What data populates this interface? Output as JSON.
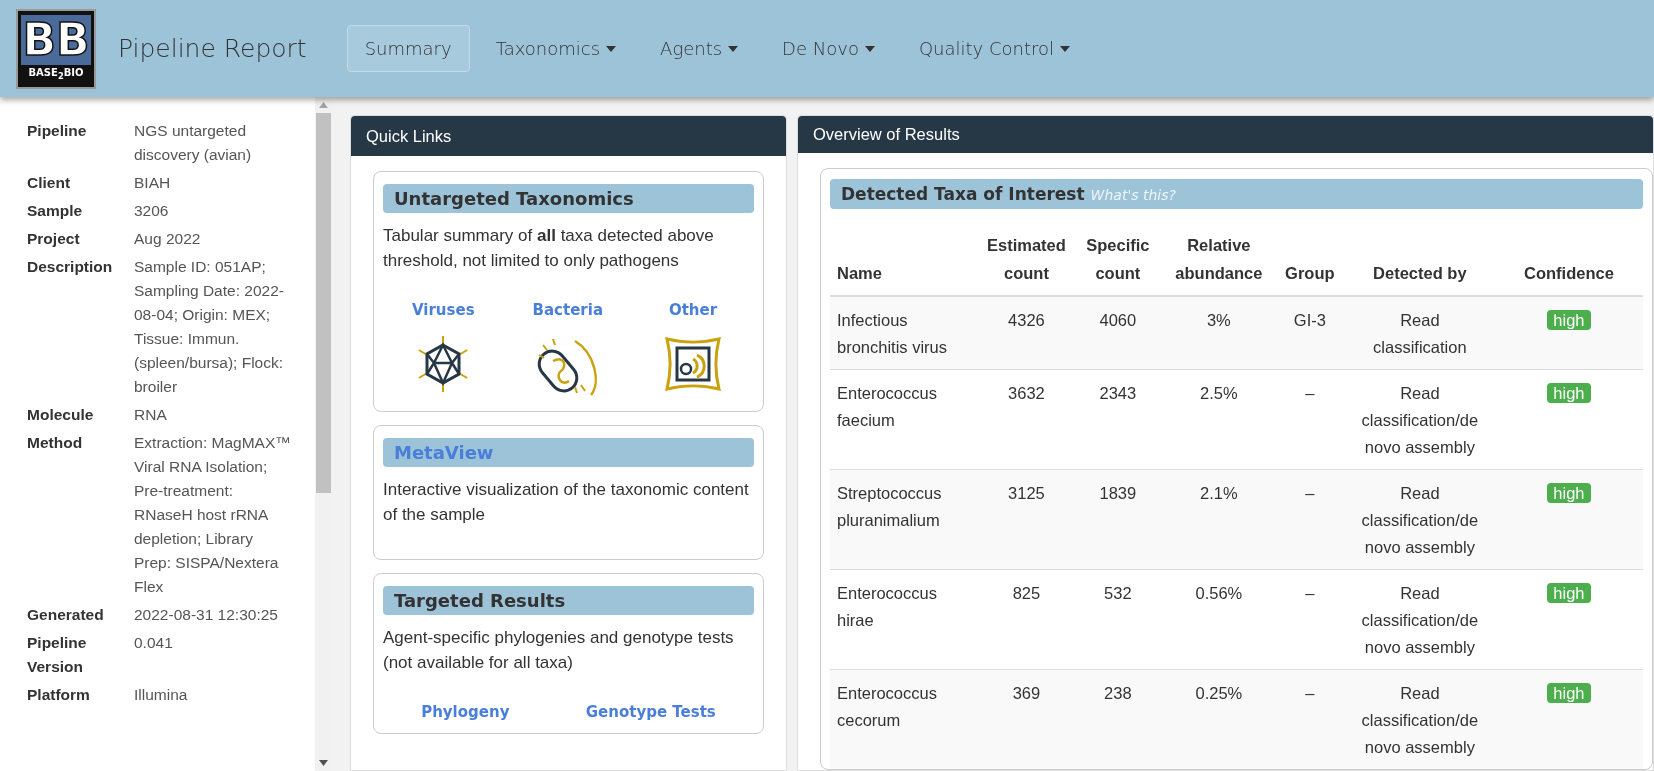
{
  "header": {
    "logo": {
      "letters": [
        "B",
        "B"
      ],
      "wordmark": "BASE$_{2}$BIO"
    },
    "title": "Pipeline Report",
    "nav": [
      {
        "label": "Summary",
        "selected": true,
        "dropdown": false
      },
      {
        "label": "Taxonomics",
        "selected": false,
        "dropdown": true
      },
      {
        "label": "Agents",
        "selected": false,
        "dropdown": true
      },
      {
        "label": "De Novo",
        "selected": false,
        "dropdown": true
      },
      {
        "label": "Quality Control",
        "selected": false,
        "dropdown": true
      }
    ]
  },
  "sidebar": {
    "items": [
      {
        "label": "Pipeline",
        "value": "NGS untargeted discovery (avian)"
      },
      {
        "label": "Client",
        "value": "BIAH"
      },
      {
        "label": "Sample",
        "value": "3206"
      },
      {
        "label": "Project",
        "value": "Aug 2022"
      },
      {
        "label": "Description",
        "value": "Sample ID: 051AP; Sampling Date: 2022-08-04; Origin: MEX; Tissue: Immun. (spleen/bursa); Flock: broiler"
      },
      {
        "label": "Molecule",
        "value": "RNA"
      },
      {
        "label": "Method",
        "value": "Extraction: MagMAX™ Viral RNA Isolation; Pre-treatment: RNaseH host rRNA depletion; Library Prep: SISPA/Nextera Flex"
      },
      {
        "label": "Generated",
        "value": "2022-08-31 12:30:25"
      },
      {
        "label": "Pipeline Version",
        "value": "0.041"
      },
      {
        "label": "Platform",
        "value": "Illumina"
      }
    ]
  },
  "quick_links": {
    "title": "Quick Links",
    "cards": [
      {
        "title": "Untargeted Taxonomics",
        "title_is_link": false,
        "text": "Tabular summary of **all** taxa detected above threshold, not limited to only pathogens",
        "links": [
          {
            "label": "Viruses",
            "kind": "virus"
          },
          {
            "label": "Bacteria",
            "kind": "bacteria"
          },
          {
            "label": "Other",
            "kind": "other"
          }
        ]
      },
      {
        "title": "MetaView",
        "title_is_link": true,
        "text": "Interactive visualization of the taxonomic content of the sample"
      },
      {
        "title": "Targeted Results",
        "title_is_link": false,
        "text": "Agent-specific phylogenies and genotype tests (not available for all taxa)",
        "links": [
          {
            "label": "Phylogeny",
            "kind": "none"
          },
          {
            "label": "Genotype Tests",
            "kind": "none"
          }
        ]
      }
    ]
  },
  "overview": {
    "title": "Overview of Results",
    "card_title": "Detected Taxa of Interest",
    "help_link": "What's this?",
    "table": {
      "columns": [
        {
          "lines": [
            "Name"
          ]
        },
        {
          "lines": [
            "Estimated",
            "count"
          ]
        },
        {
          "lines": [
            "Specific",
            "count"
          ]
        },
        {
          "lines": [
            "Relative",
            "abundance"
          ]
        },
        {
          "lines": [
            "Group"
          ]
        },
        {
          "lines": [
            "Detected by"
          ]
        },
        {
          "lines": [
            "Confidence"
          ]
        }
      ],
      "rows": [
        {
          "name": "Infectious bronchitis virus",
          "estimated": "4326",
          "specific": "4060",
          "abundance": "3%",
          "group": "GI-3",
          "detected_by": "Read classification",
          "confidence": "high"
        },
        {
          "name": "Enterococcus faecium",
          "estimated": "3632",
          "specific": "2343",
          "abundance": "2.5%",
          "group": "–",
          "detected_by": "Read classification/de novo assembly",
          "confidence": "high"
        },
        {
          "name": "Streptococcus pluranimalium",
          "estimated": "3125",
          "specific": "1839",
          "abundance": "2.1%",
          "group": "–",
          "detected_by": "Read classification/de novo assembly",
          "confidence": "high"
        },
        {
          "name": "Enterococcus hirae",
          "estimated": "825",
          "specific": "532",
          "abundance": "0.56%",
          "group": "–",
          "detected_by": "Read classification/de novo assembly",
          "confidence": "high"
        },
        {
          "name": "Enterococcus cecorum",
          "estimated": "369",
          "specific": "238",
          "abundance": "0.25%",
          "group": "–",
          "detected_by": "Read classification/de novo assembly",
          "confidence": "high"
        }
      ]
    }
  }
}
